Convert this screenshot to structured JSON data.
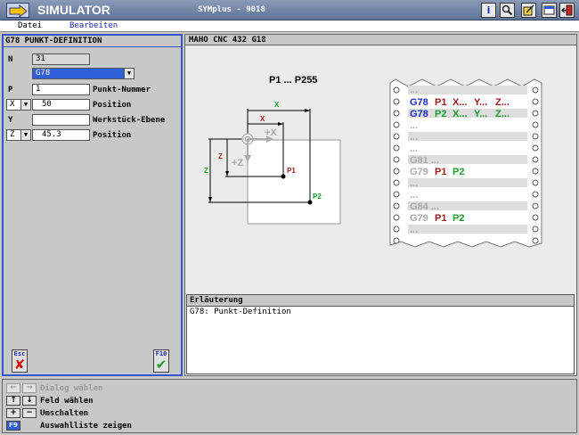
{
  "window": {
    "app_title": "SIMULATOR",
    "machine_title": "SYMplus - 9018",
    "toolbar_icons": [
      "info-icon",
      "search-icon",
      "edit-icon",
      "window-icon",
      "exit-icon"
    ]
  },
  "menu": {
    "items": [
      "Datei",
      "Bearbeiten"
    ]
  },
  "dialog": {
    "title": "G78 PUNKT-DEFINITION",
    "n_label": "N",
    "n_value": "31",
    "gcode_select": "G78",
    "p_label": "P",
    "p_value": "1",
    "p_desc": "Punkt-Nummer",
    "x_axis": "X",
    "x_value": "50",
    "x_desc": "Position",
    "y_label": "Y",
    "y_value": "",
    "y_desc": "Werkstück-Ebene",
    "z_axis": "Z",
    "z_value": "45.3",
    "z_desc": "Position",
    "esc_key": "Esc",
    "f10_key": "F10"
  },
  "display": {
    "title": "MAHO CNC 432 G18",
    "diagram": {
      "heading": "P1 ... P255",
      "x_small": "X",
      "x_large": "X",
      "z_small": "Z",
      "z_large": "Z",
      "plus_x": "+X",
      "plus_z": "+Z",
      "p1": "P1",
      "p2": "P2"
    },
    "tape": {
      "dots": "...",
      "line1": {
        "g": "G78",
        "p": "P1",
        "x": "X...",
        "y": "Y...",
        "z": "Z..."
      },
      "line2": {
        "g": "G78",
        "p": "P2",
        "x": "X...",
        "y": "Y...",
        "z": "Z..."
      },
      "g81": "G81 ...",
      "g79a": {
        "g": "G79",
        "p1": "P1",
        "p2": "P2"
      },
      "g84": "G84 ...",
      "g79b": {
        "g": "G79",
        "p1": "P1",
        "p2": "P2"
      }
    }
  },
  "explain": {
    "title": "Erläuterung",
    "text": "G78: Punkt-Definition"
  },
  "help": {
    "rows": [
      {
        "keys": [
          "←",
          "→"
        ],
        "text": "Dialog wählen",
        "dim": true
      },
      {
        "keys": [
          "↑",
          "↓"
        ],
        "text": "Feld wählen",
        "dim": false
      },
      {
        "keys": [
          "+",
          "−"
        ],
        "text": "Umschalten",
        "dim": false
      },
      {
        "keys": [
          "F9"
        ],
        "text": "Auswahlliste zeigen",
        "dim": false
      }
    ]
  },
  "colors": {
    "accent_blue": "#3355cc",
    "g78_blue": "#1b2fc8",
    "p_red": "#a01818",
    "xyz_green": "#179c2a"
  }
}
